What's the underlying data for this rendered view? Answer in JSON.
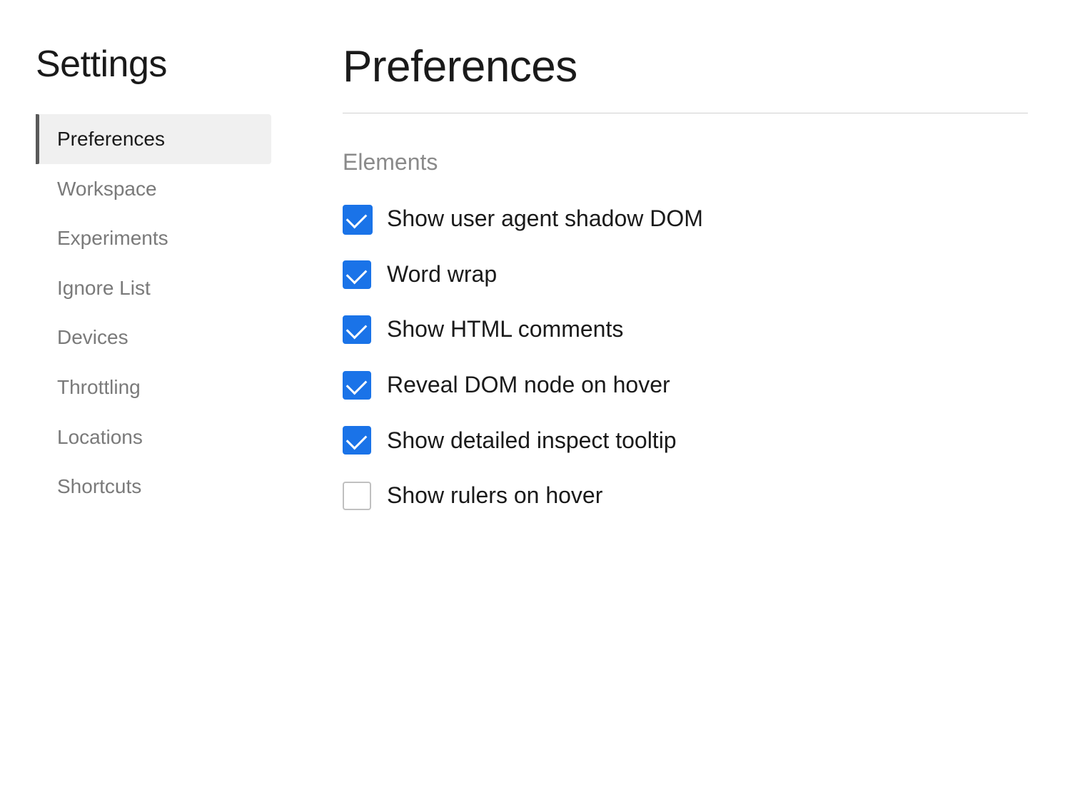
{
  "sidebar": {
    "title": "Settings",
    "nav_items": [
      {
        "id": "preferences",
        "label": "Preferences",
        "active": true
      },
      {
        "id": "workspace",
        "label": "Workspace",
        "active": false
      },
      {
        "id": "experiments",
        "label": "Experiments",
        "active": false
      },
      {
        "id": "ignore-list",
        "label": "Ignore List",
        "active": false
      },
      {
        "id": "devices",
        "label": "Devices",
        "active": false
      },
      {
        "id": "throttling",
        "label": "Throttling",
        "active": false
      },
      {
        "id": "locations",
        "label": "Locations",
        "active": false
      },
      {
        "id": "shortcuts",
        "label": "Shortcuts",
        "active": false
      }
    ]
  },
  "main": {
    "page_title": "Preferences",
    "section_title": "Elements",
    "settings": [
      {
        "id": "shadow-dom",
        "label": "Show user agent shadow DOM",
        "checked": true,
        "prominent": true
      },
      {
        "id": "word-wrap",
        "label": "Word wrap",
        "checked": true,
        "prominent": false
      },
      {
        "id": "html-comments",
        "label": "Show HTML comments",
        "checked": true,
        "prominent": false
      },
      {
        "id": "dom-hover",
        "label": "Reveal DOM node on hover",
        "checked": true,
        "prominent": false
      },
      {
        "id": "inspect-tooltip",
        "label": "Show detailed inspect tooltip",
        "checked": true,
        "prominent": false
      },
      {
        "id": "rulers-hover",
        "label": "Show rulers on hover",
        "checked": false,
        "prominent": false
      }
    ]
  }
}
